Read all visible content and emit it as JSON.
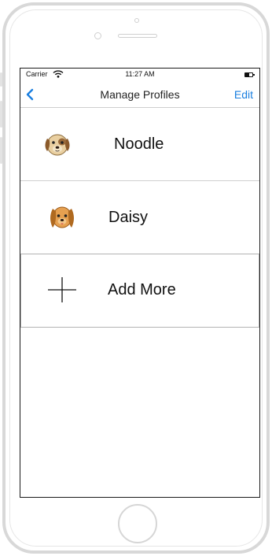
{
  "status_bar": {
    "carrier": "Carrier",
    "time": "11:27 AM"
  },
  "nav": {
    "title": "Manage Profiles",
    "edit_label": "Edit",
    "accent_color": "#1a7fe0"
  },
  "profiles": [
    {
      "name": "Noodle",
      "icon": "dog-face-icon"
    },
    {
      "name": "Daisy",
      "icon": "dog-face-icon"
    }
  ],
  "add_row": {
    "label": "Add More",
    "icon": "plus-icon"
  }
}
